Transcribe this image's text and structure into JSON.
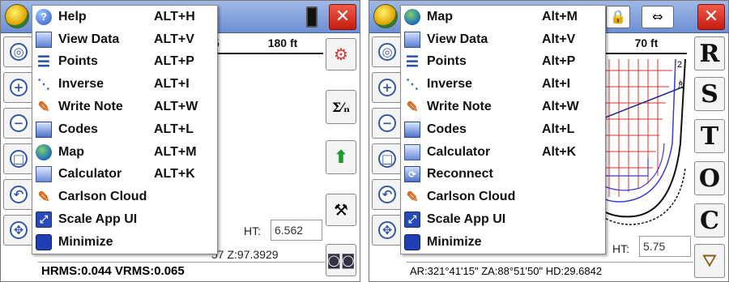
{
  "screens": [
    {
      "menu_items": [
        {
          "label": "Help",
          "shortcut": "ALT+H",
          "icon": "help-icon"
        },
        {
          "label": "View Data",
          "shortcut": "ALT+V",
          "icon": "view-data-icon"
        },
        {
          "label": "Points",
          "shortcut": "ALT+P",
          "icon": "points-icon"
        },
        {
          "label": "Inverse",
          "shortcut": "ALT+I",
          "icon": "inverse-icon"
        },
        {
          "label": "Write Note",
          "shortcut": "ALT+W",
          "icon": "pencil-icon"
        },
        {
          "label": "Codes",
          "shortcut": "ALT+L",
          "icon": "codes-book-icon"
        },
        {
          "label": "Map",
          "shortcut": "ALT+M",
          "icon": "globe-icon"
        },
        {
          "label": "Calculator",
          "shortcut": "ALT+K",
          "icon": "calculator-icon"
        },
        {
          "label": "Carlson Cloud",
          "shortcut": "",
          "icon": "pencil-icon"
        },
        {
          "label": "Scale App UI",
          "shortcut": "",
          "icon": "scale-icon"
        },
        {
          "label": "Minimize",
          "shortcut": "",
          "icon": "minimize-icon"
        }
      ],
      "scale_partial": "5",
      "scale_value": "180 ft",
      "ht_label": "HT:",
      "ht_value": "6.562",
      "z_readout": "57  Z:97.3929",
      "status_text": "HRMS:0.044 VRMS:0.065"
    },
    {
      "menu_items": [
        {
          "label": "Map",
          "shortcut": "Alt+M",
          "icon": "globe-icon"
        },
        {
          "label": "View Data",
          "shortcut": "Alt+V",
          "icon": "view-data-icon"
        },
        {
          "label": "Points",
          "shortcut": "Alt+P",
          "icon": "points-icon"
        },
        {
          "label": "Inverse",
          "shortcut": "Alt+I",
          "icon": "inverse-icon"
        },
        {
          "label": "Write Note",
          "shortcut": "Alt+W",
          "icon": "pencil-icon"
        },
        {
          "label": "Codes",
          "shortcut": "Alt+L",
          "icon": "codes-book-icon"
        },
        {
          "label": "Calculator",
          "shortcut": "Alt+K",
          "icon": "calculator-icon"
        },
        {
          "label": "Reconnect",
          "shortcut": "",
          "icon": "reconnect-icon"
        },
        {
          "label": "Carlson Cloud",
          "shortcut": "",
          "icon": "pencil-icon"
        },
        {
          "label": "Scale App UI",
          "shortcut": "",
          "icon": "scale-icon"
        },
        {
          "label": "Minimize",
          "shortcut": "",
          "icon": "minimize-icon"
        }
      ],
      "scale_value": "70 ft",
      "map_label_2": "2",
      "map_label_1": "1",
      "ht_label": "HT:",
      "ht_value": "5.75",
      "status_text": "AR:321°41'15\"  ZA:88°51'50\"   HD:29.6842",
      "side_buttons": [
        "R",
        "S",
        "T",
        "O",
        "C"
      ]
    }
  ],
  "colors": {
    "titlebar": "#7c9bdc",
    "close_red": "#d8281a",
    "map_red": "#e0302a",
    "map_blue": "#3a3ad6"
  }
}
